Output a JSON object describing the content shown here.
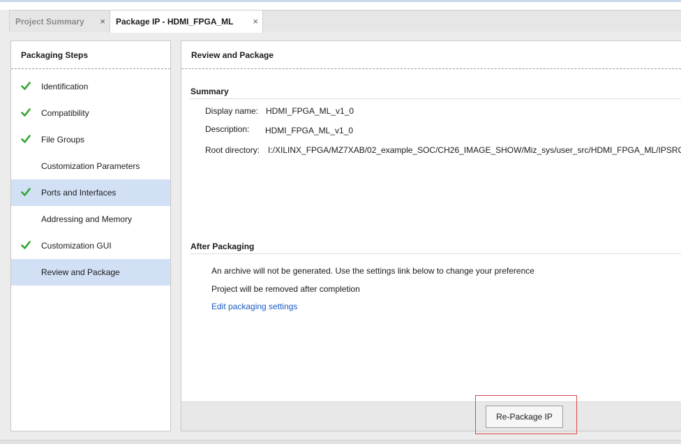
{
  "tabs": [
    {
      "label": "Project Summary",
      "active": false,
      "close": "×"
    },
    {
      "label": "Package IP - HDMI_FPGA_ML",
      "active": true,
      "close": "×"
    }
  ],
  "left_pane": {
    "title": "Packaging Steps",
    "steps": [
      {
        "label": "Identification",
        "checked": true,
        "selected": false
      },
      {
        "label": "Compatibility",
        "checked": true,
        "selected": false
      },
      {
        "label": "File Groups",
        "checked": true,
        "selected": false
      },
      {
        "label": "Customization Parameters",
        "checked": false,
        "selected": false
      },
      {
        "label": "Ports and Interfaces",
        "checked": true,
        "selected": true
      },
      {
        "label": "Addressing and Memory",
        "checked": false,
        "selected": false
      },
      {
        "label": "Customization GUI",
        "checked": true,
        "selected": false
      },
      {
        "label": "Review and Package",
        "checked": false,
        "selected": true
      }
    ]
  },
  "right_pane": {
    "title": "Review and Package",
    "summary": {
      "heading": "Summary",
      "display_name_label": "Display name:",
      "display_name_value": "HDMI_FPGA_ML_v1_0",
      "description_label": "Description:",
      "description_value": "HDMI_FPGA_ML_v1_0",
      "root_dir_label": "Root directory:",
      "root_dir_value": "I:/XILINX_FPGA/MZ7XAB/02_example_SOC/CH26_IMAGE_SHOW/Miz_sys/user_src/HDMI_FPGA_ML/IPSRC"
    },
    "after_packaging": {
      "heading": "After Packaging",
      "line1": "An archive will not be generated. Use the settings link below to change your preference",
      "line2": "Project will be removed after completion",
      "link": "Edit packaging settings"
    },
    "repackage_button": "Re-Package IP"
  },
  "colors": {
    "check": "#2fa52f",
    "selected_row": "#d2e0f6",
    "link": "#1a5bc5",
    "highlight": "#d94a4a"
  },
  "icons": {
    "check": "checkmark-icon",
    "close": "close-icon"
  }
}
